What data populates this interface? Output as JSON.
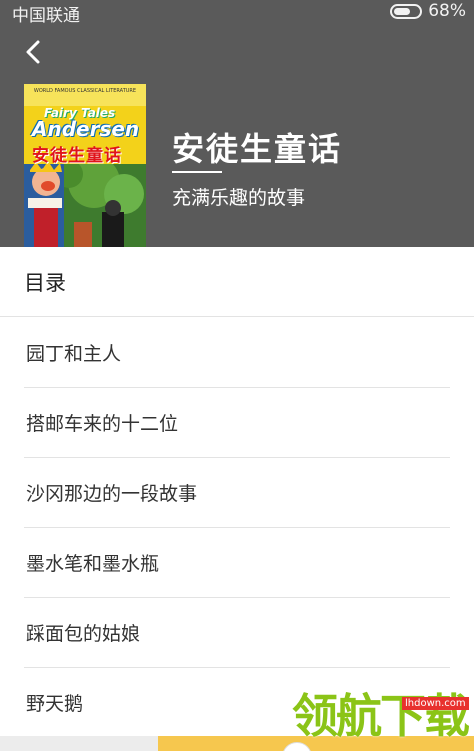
{
  "status_bar": {
    "carrier": "中国联通",
    "battery_percent": "68%",
    "battery_level": 0.68
  },
  "book": {
    "title": "安徒生童话",
    "subtitle": "充满乐趣的故事",
    "cover": {
      "series_line": "WORLD FAMOUS CLASSICAL LITERATURE",
      "title_en_top": "Fairy Tales",
      "title_en_author": "Andersen",
      "title_zh": "安徒生童话"
    }
  },
  "toc": {
    "heading": "目录",
    "chapters": [
      {
        "label": "园丁和主人"
      },
      {
        "label": "搭邮车来的十二位"
      },
      {
        "label": "沙冈那边的一段故事"
      },
      {
        "label": "墨水笔和墨水瓶"
      },
      {
        "label": "踩面包的姑娘"
      },
      {
        "label": "野天鹅"
      }
    ]
  },
  "watermark": {
    "text": "领航下载",
    "url": "lhdown.com"
  },
  "colors": {
    "header_bg": "#5a5a5a",
    "divider": "#e3e3e3",
    "cover_yellow": "#f3d21a",
    "watermark_green": "#8bc417"
  }
}
